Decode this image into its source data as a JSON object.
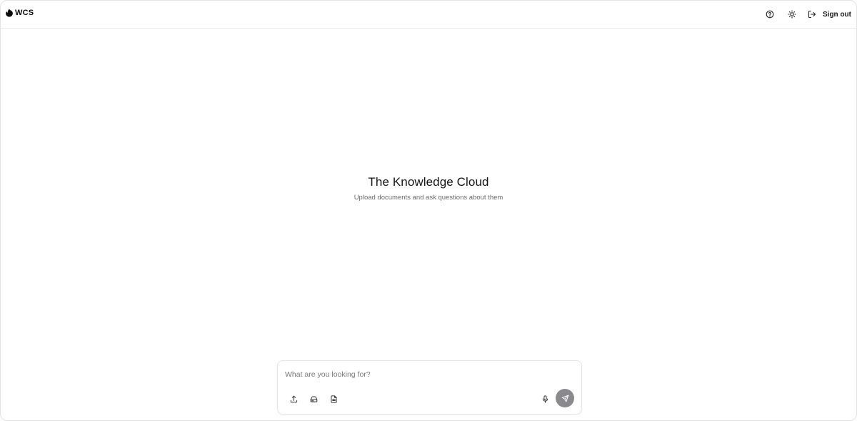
{
  "header": {
    "brand": "WCS",
    "help_icon": "help-circle-icon",
    "theme_icon": "sun-icon",
    "signout_icon": "log-out-icon",
    "signout_label": "Sign out"
  },
  "hero": {
    "title": "The Knowledge Cloud",
    "subtitle": "Upload documents and ask questions about them"
  },
  "composer": {
    "placeholder": "What are you looking for?",
    "value": "",
    "tools": [
      "upload-icon",
      "drive-icon",
      "document-icon"
    ],
    "mic_icon": "microphone-icon",
    "send_icon": "send-icon"
  },
  "colors": {
    "send_button": "#8a8a8e",
    "border": "#e5e5e5",
    "text_muted": "#6a6a6a"
  }
}
